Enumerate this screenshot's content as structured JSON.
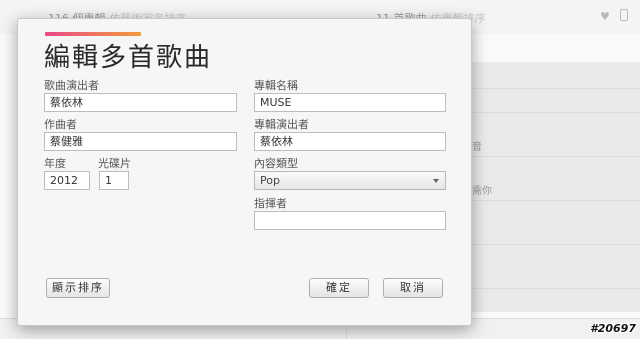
{
  "background": {
    "header_left": "116 個專輯",
    "header_left_sub": "依藝術家名排序",
    "header_right": "11 首歌曲",
    "header_right_sub": "依專輯排序",
    "row_text_1": "音",
    "row_text_2": "需你"
  },
  "dialog": {
    "title": "編輯多首歌曲",
    "accent_gradient": [
      "#e84a8a",
      "#f29b3b"
    ],
    "fields": {
      "artist": {
        "label": "歌曲演出者",
        "value": "蔡依林"
      },
      "composer": {
        "label": "作曲者",
        "value": "蔡健雅"
      },
      "year": {
        "label": "年度",
        "value": "2012"
      },
      "disc": {
        "label": "光碟片",
        "value": "1"
      },
      "album": {
        "label": "專輯名稱",
        "value": "MUSE"
      },
      "album_artist": {
        "label": "專輯演出者",
        "value": "蔡依林"
      },
      "genre": {
        "label": "內容類型",
        "value": "Pop"
      },
      "conductor": {
        "label": "指揮者",
        "value": ""
      }
    },
    "buttons": {
      "show_sort": "顯示排序",
      "ok": "確定",
      "cancel": "取消"
    }
  },
  "watermark": "#20697"
}
